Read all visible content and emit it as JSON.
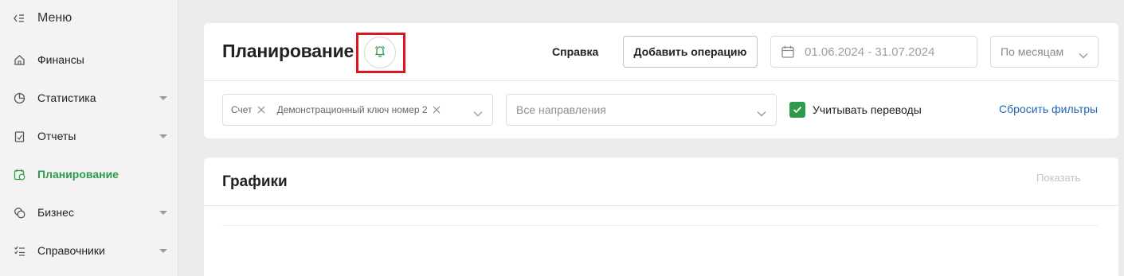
{
  "sidebar": {
    "menu_label": "Меню",
    "items": [
      {
        "label": "Финансы",
        "icon": "home-icon",
        "has_children": false,
        "active": false
      },
      {
        "label": "Статистика",
        "icon": "pie-chart-icon",
        "has_children": true,
        "active": false
      },
      {
        "label": "Отчеты",
        "icon": "report-icon",
        "has_children": true,
        "active": false
      },
      {
        "label": "Планирование",
        "icon": "calendar-clock-icon",
        "has_children": false,
        "active": true
      },
      {
        "label": "Бизнес",
        "icon": "coins-icon",
        "has_children": true,
        "active": false
      },
      {
        "label": "Справочники",
        "icon": "checklist-icon",
        "has_children": true,
        "active": false
      }
    ]
  },
  "header": {
    "title": "Планирование",
    "bell_icon": "bell-icon",
    "help_label": "Справка",
    "add_button_label": "Добавить операцию",
    "date_range": "01.06.2024 - 31.07.2024",
    "period_value": "По месяцам"
  },
  "filters": {
    "account_chips": [
      "Счет",
      "Демонстрационный ключ номер 2"
    ],
    "direction_placeholder": "Все направления",
    "transfers_label": "Учитывать переводы",
    "transfers_checked": true,
    "reset_label": "Сбросить фильтры"
  },
  "charts": {
    "title": "Графики",
    "show_label": "Показать"
  },
  "colors": {
    "accent": "#2e9b4a",
    "link": "#1f67b0",
    "highlight": "#e0141e"
  }
}
